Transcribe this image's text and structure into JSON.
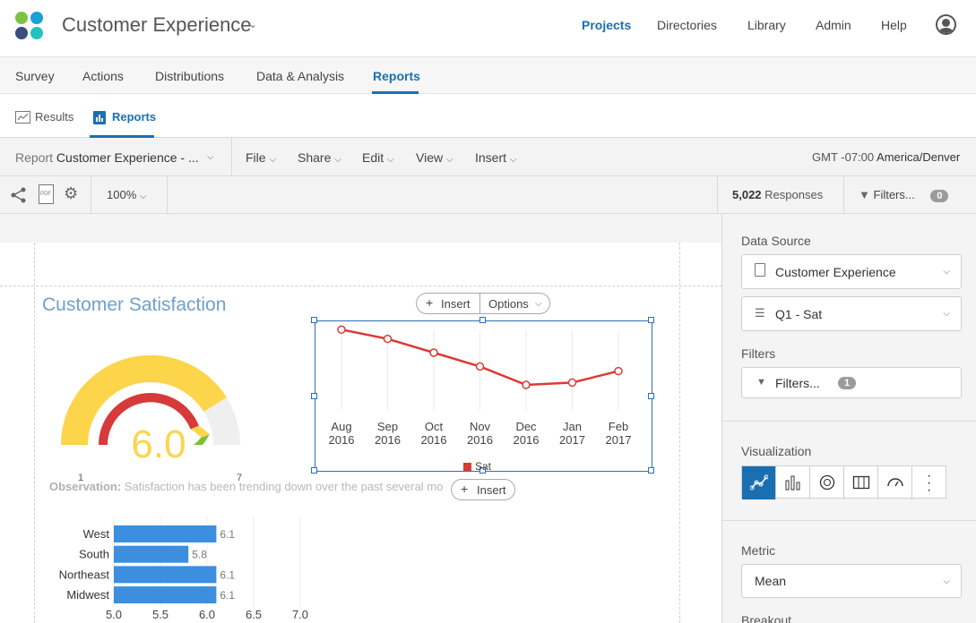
{
  "header": {
    "title": "Customer Experience",
    "nav": [
      "Projects",
      "Directories",
      "Library",
      "Admin",
      "Help"
    ],
    "active_nav": "Projects",
    "logo_colors": [
      "#7fc241",
      "#1aa0d6",
      "#3b4c7d",
      "#22c3be"
    ]
  },
  "tabs": [
    "Survey",
    "Actions",
    "Distributions",
    "Data & Analysis",
    "Reports"
  ],
  "active_tab": "Reports",
  "subtabs": {
    "results": "Results",
    "reports": "Reports"
  },
  "toolbar": {
    "report_label": "Report",
    "report_name": "Customer Experience - ...",
    "menus": [
      "File",
      "Share",
      "Edit",
      "View",
      "Insert"
    ],
    "timezone_prefix": "GMT -07:00",
    "timezone_region": "America/Denver",
    "zoom": "100%",
    "responses_count": "5,022",
    "responses_label": "Responses",
    "filters_label": "Filters...",
    "filters_count": "0",
    "pdf_label": "PDF"
  },
  "widget": {
    "title": "Customer Satisfaction",
    "gauge": {
      "value": "6.0",
      "min_label": "1",
      "max_label": "7"
    },
    "observation_label": "Observation:",
    "observation_text": "Satisfaction has been trending down over the past several mo",
    "insert_label": "Insert",
    "options_label": "Options",
    "insert_bottom_label": "Insert"
  },
  "chart_data": [
    {
      "type": "line",
      "categories": [
        [
          "Aug",
          "2016"
        ],
        [
          "Sep",
          "2016"
        ],
        [
          "Oct",
          "2016"
        ],
        [
          "Nov",
          "2016"
        ],
        [
          "Dec",
          "2016"
        ],
        [
          "Jan",
          "2017"
        ],
        [
          "Feb",
          "2017"
        ]
      ],
      "series": [
        {
          "name": "Sat",
          "values": [
            6.4,
            6.2,
            5.9,
            5.6,
            5.2,
            5.25,
            5.5
          ],
          "color": "#d93b35"
        }
      ],
      "ylim": [
        4.5,
        6.6
      ],
      "legend": "bottom"
    },
    {
      "type": "bar",
      "orientation": "horizontal",
      "categories": [
        "West",
        "South",
        "Northeast",
        "Midwest"
      ],
      "values": [
        6.1,
        5.8,
        6.1,
        6.1
      ],
      "data_labels": [
        "6.1",
        "5.8",
        "6.1",
        "6.1"
      ],
      "xlim": [
        5.0,
        7.0
      ],
      "xticks": [
        "5.0",
        "5.5",
        "6.0",
        "6.5",
        "7.0"
      ],
      "color": "#3b8fde"
    }
  ],
  "panel": {
    "data_source_label": "Data Source",
    "data_source": "Customer Experience",
    "question": "Q1 - Sat",
    "filters_label": "Filters",
    "filters_button": "Filters...",
    "filters_count": "1",
    "visualization_label": "Visualization",
    "metric_label": "Metric",
    "metric_value": "Mean",
    "breakout_label": "Breakout"
  }
}
